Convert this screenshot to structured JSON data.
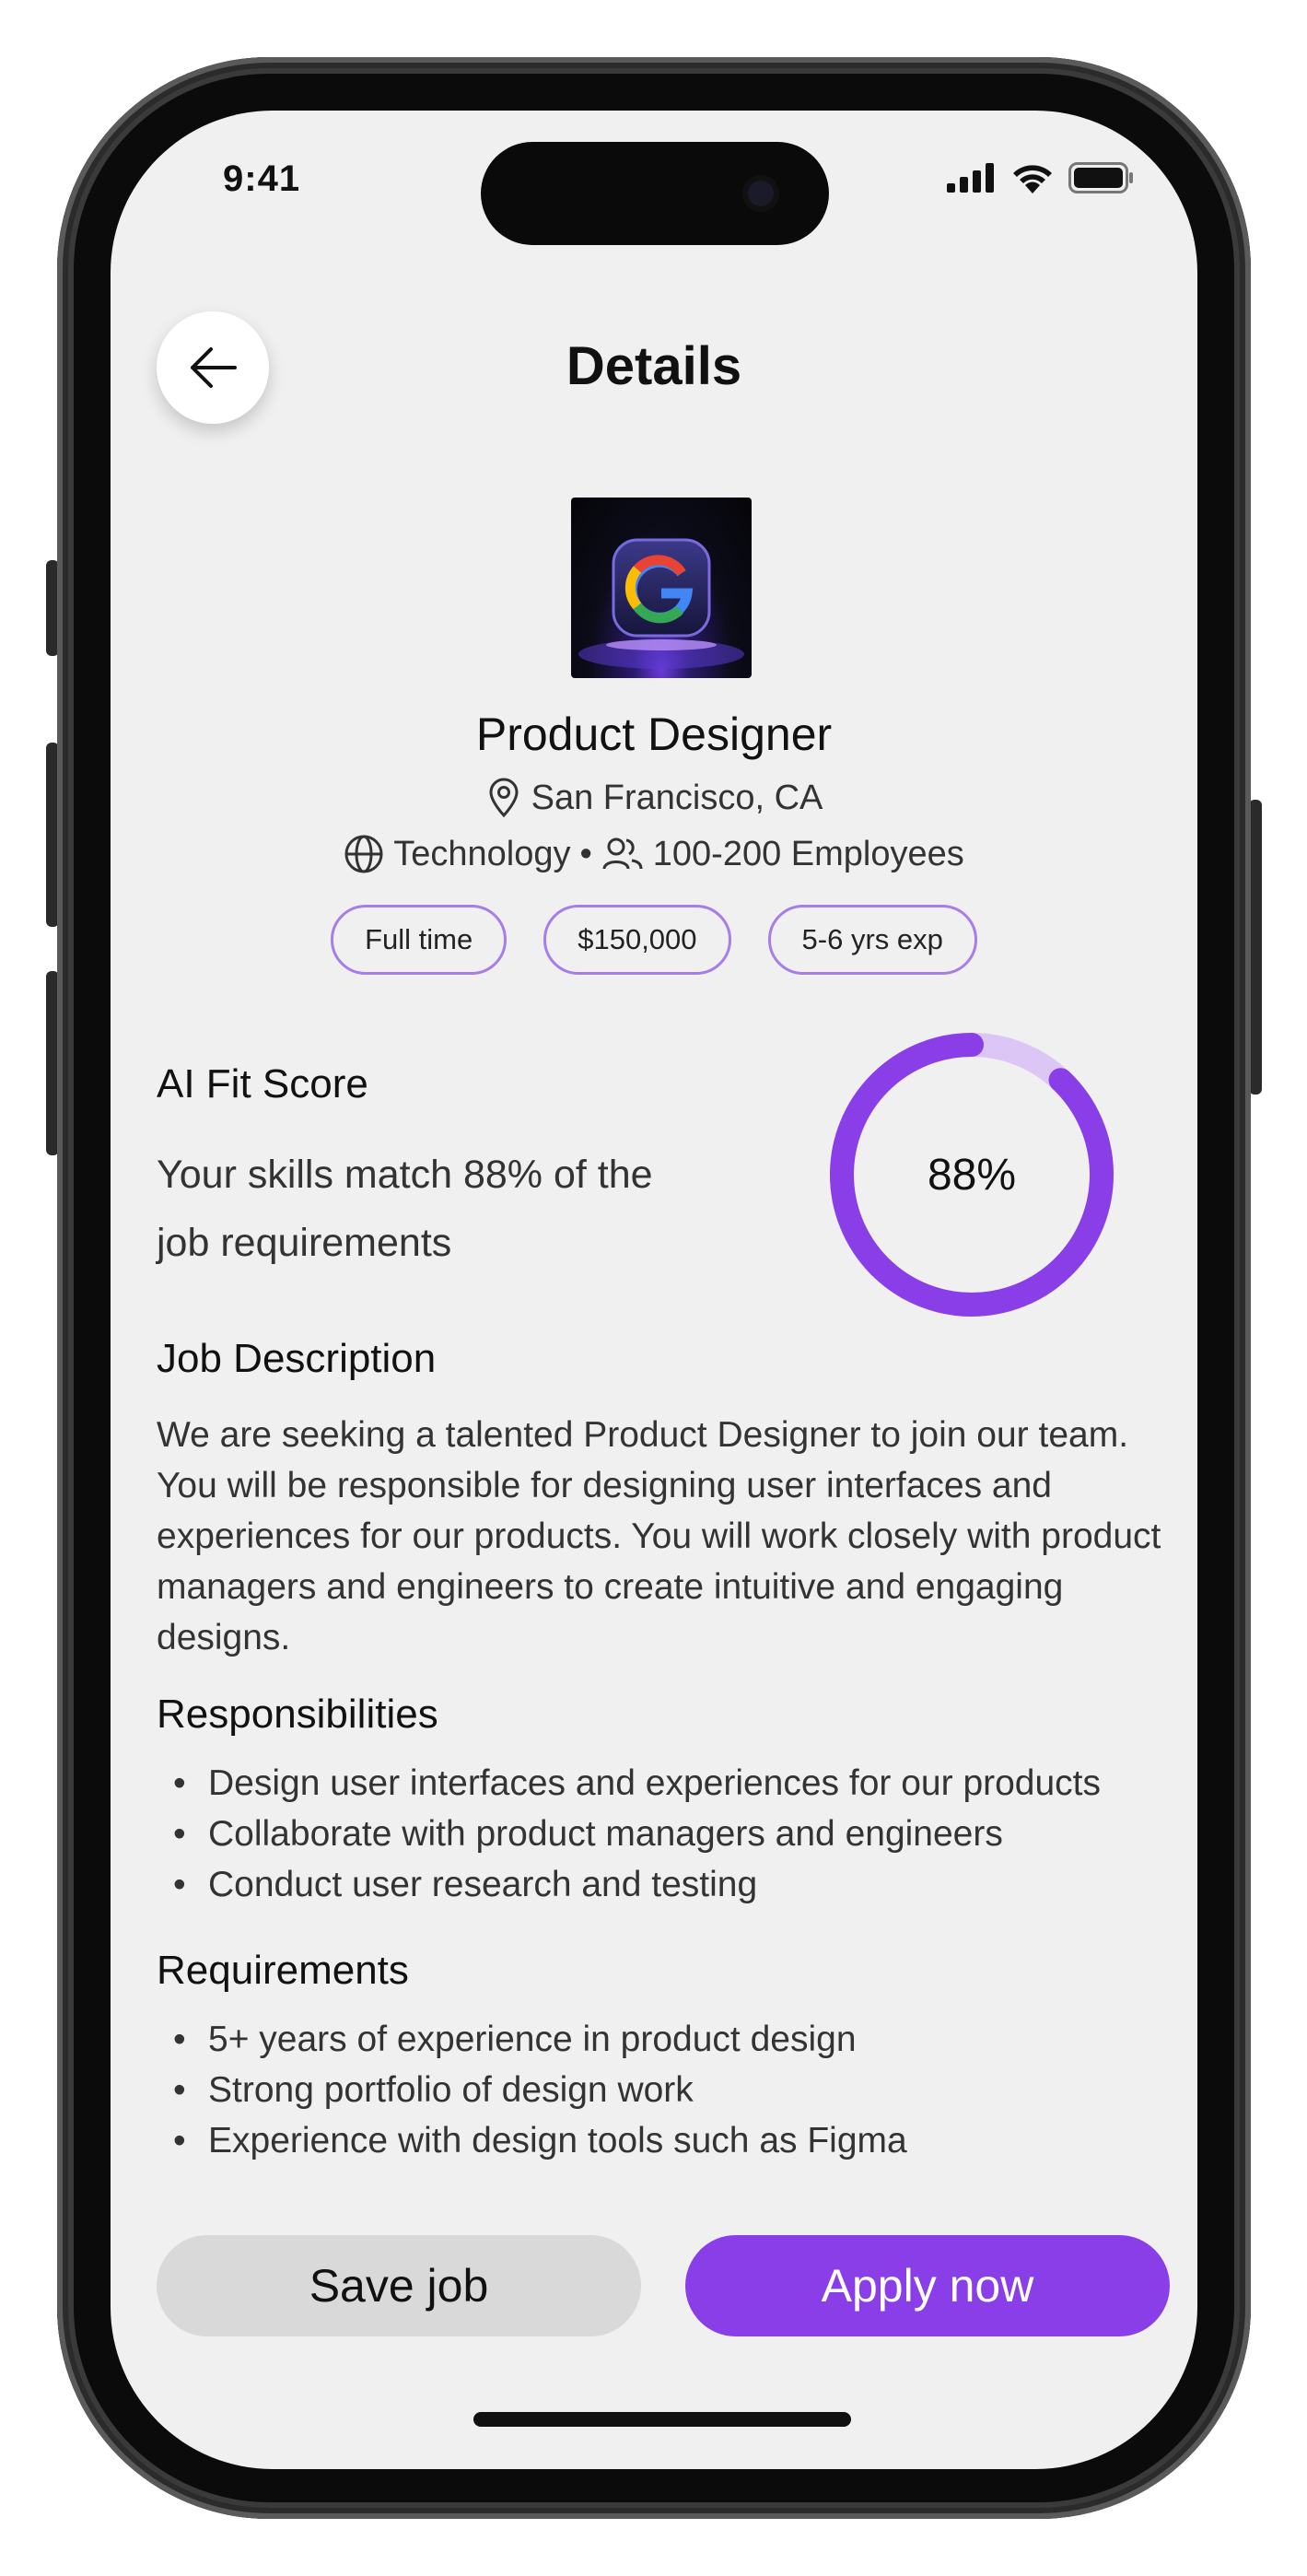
{
  "status_bar": {
    "time": "9:41"
  },
  "header": {
    "title": "Details",
    "back_icon": "arrow-left-icon"
  },
  "job": {
    "company_logo": "google-logo",
    "title": "Product Designer",
    "location": "San Francisco, CA",
    "industry": "Technology",
    "separator": "•",
    "employees": "100-200 Employees",
    "tags": [
      "Full time",
      "$150,000",
      "5-6 yrs exp"
    ]
  },
  "ai_fit": {
    "heading": "AI Fit Score",
    "text": "Your skills match 88% of the job requirements",
    "score_label": "88%",
    "score_value": 0.88,
    "accent_color": "#8a3ee8",
    "track_color": "#dcc6f5"
  },
  "description": {
    "heading": "Job Description",
    "text": "We are seeking a talented Product Designer to join our team. You will be responsible for designing user interfaces and experiences for our products. You will work closely with product managers and engineers to create intuitive and engaging designs."
  },
  "responsibilities": {
    "heading": "Responsibilities",
    "items": [
      "Design user interfaces and experiences for our products",
      "Collaborate with product managers and engineers",
      "Conduct user research and testing"
    ]
  },
  "requirements": {
    "heading": "Requirements",
    "items": [
      "5+ years of experience in product design",
      "Strong portfolio of design work",
      "Experience with design tools such as Figma"
    ]
  },
  "actions": {
    "save_label": "Save job",
    "apply_label": "Apply now"
  }
}
